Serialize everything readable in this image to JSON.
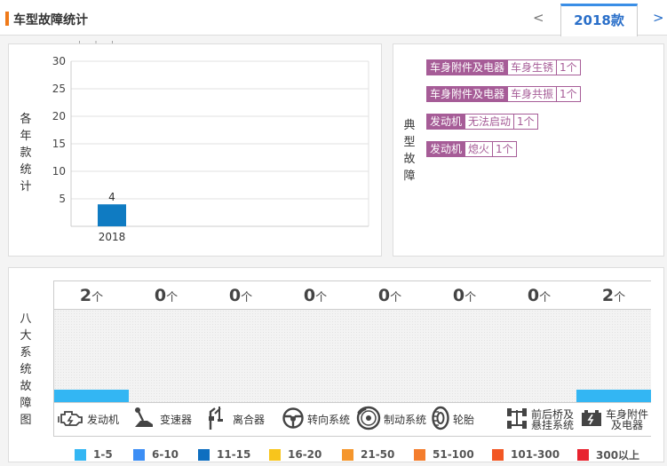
{
  "header": {
    "title": "车型故障统计",
    "prev": "<",
    "next": ">",
    "year_tab": "2018款"
  },
  "yearly": {
    "label": "各年款统计",
    "top_fragment": "' ' '",
    "chart_data": {
      "type": "bar",
      "categories": [
        "2018"
      ],
      "values": [
        4
      ],
      "ylim": [
        0,
        30
      ],
      "yticks": [
        5,
        10,
        15,
        20,
        25,
        30
      ],
      "bar_color": "#0f7bc2"
    }
  },
  "typical": {
    "label": "典型故障",
    "items": [
      {
        "system": "车身附件及电器",
        "fault": "车身生锈",
        "count": "1个"
      },
      {
        "system": "车身附件及电器",
        "fault": "车身共振",
        "count": "1个"
      },
      {
        "system": "发动机",
        "fault": "无法启动",
        "count": "1个"
      },
      {
        "system": "发动机",
        "fault": "熄火",
        "count": "1个"
      }
    ]
  },
  "systems": {
    "label": "八大系统故障图",
    "unit": "个",
    "fill_color": "#33b6f3",
    "items": [
      {
        "count": "2",
        "level": 0.13,
        "icon": "engine-icon",
        "label": "发动机"
      },
      {
        "count": "0",
        "level": 0,
        "icon": "gearshift-icon",
        "label": "变速器"
      },
      {
        "count": "0",
        "level": 0,
        "icon": "clutch-pedal-icon",
        "label": "离合器"
      },
      {
        "count": "0",
        "level": 0,
        "icon": "steering-wheel-icon",
        "label": "转向系统"
      },
      {
        "count": "0",
        "level": 0,
        "icon": "brake-disc-icon",
        "label": "制动系统"
      },
      {
        "count": "0",
        "level": 0,
        "icon": "tire-icon",
        "label": "轮胎"
      },
      {
        "count": "0",
        "level": 0,
        "icon": "axle-suspension-icon",
        "label": "前后桥及悬挂系统"
      },
      {
        "count": "2",
        "level": 0.13,
        "icon": "battery-icon",
        "label": "车身附件及电器"
      }
    ]
  },
  "legend": [
    {
      "label": "1-5",
      "color": "#33b6f3"
    },
    {
      "label": "6-10",
      "color": "#3c8ef5"
    },
    {
      "label": "11-15",
      "color": "#0f6fc0"
    },
    {
      "label": "16-20",
      "color": "#f8c51c"
    },
    {
      "label": "21-50",
      "color": "#f5962c"
    },
    {
      "label": "51-100",
      "color": "#f47d2d"
    },
    {
      "label": "101-300",
      "color": "#f25724"
    },
    {
      "label": "300以上",
      "color": "#e8232f"
    }
  ]
}
